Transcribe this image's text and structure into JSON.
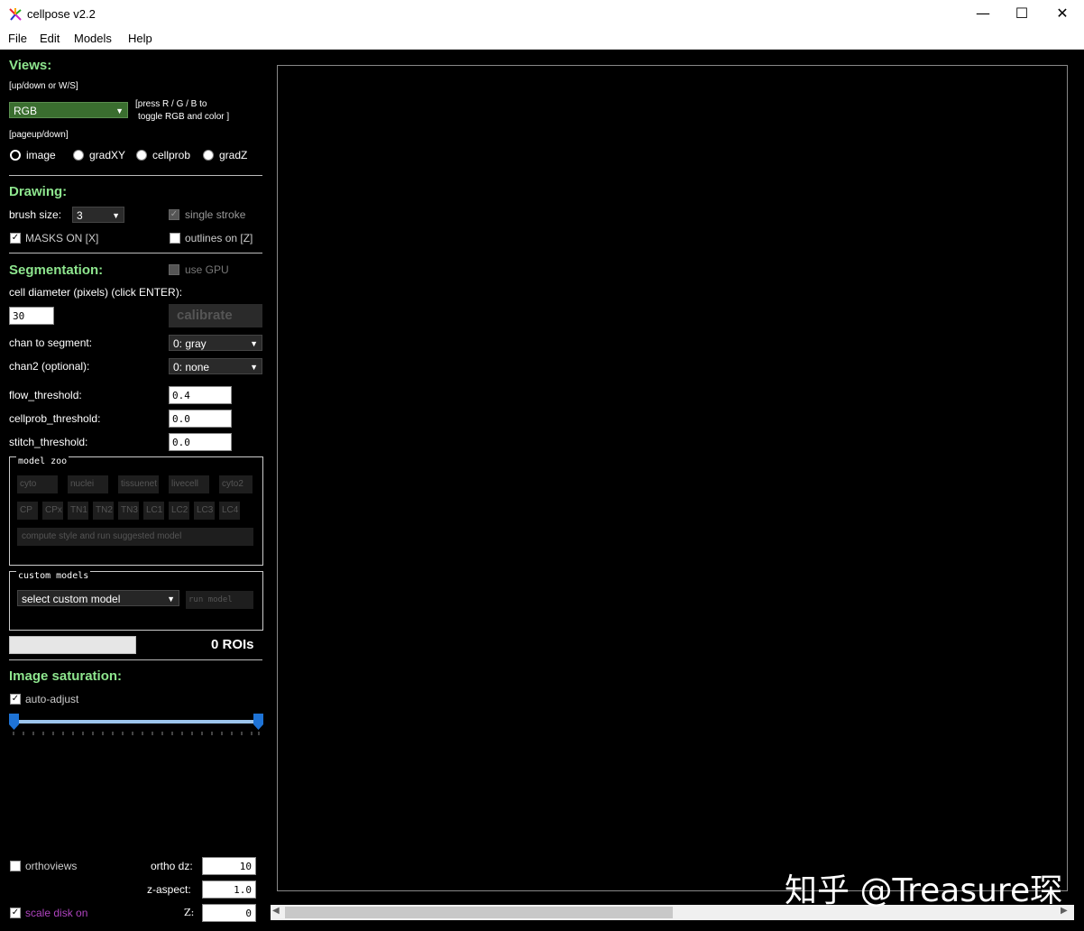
{
  "window": {
    "title": "cellpose v2.2",
    "minimize": "—",
    "maximize": "☐",
    "close": "✕"
  },
  "menu": [
    "File",
    "Edit",
    "Models",
    "Help"
  ],
  "views": {
    "header": "Views:",
    "hint_updown": "[up/down or W/S]",
    "color_mode": "RGB",
    "color_hint_line1": "[press R / G / B to",
    "color_hint_line2": "toggle RGB and color ]",
    "hint_pageupdown": "[pageup/down]",
    "radios": [
      {
        "label": "image",
        "selected": true
      },
      {
        "label": "gradXY",
        "selected": false
      },
      {
        "label": "cellprob",
        "selected": false
      },
      {
        "label": "gradZ",
        "selected": false
      }
    ]
  },
  "drawing": {
    "header": "Drawing:",
    "brush_label": "brush size:",
    "brush_value": "3",
    "single_stroke": {
      "label": "single stroke",
      "checked": true,
      "enabled": false
    },
    "masks_on": {
      "label": "MASKS ON [X]",
      "checked": true
    },
    "outlines_on": {
      "label": "outlines on [Z]",
      "checked": false
    }
  },
  "segmentation": {
    "header": "Segmentation:",
    "use_gpu": {
      "label": "use GPU",
      "checked": false,
      "enabled": false
    },
    "diameter_label": "cell diameter (pixels) (click ENTER):",
    "diameter_value": "30",
    "calibrate_label": "calibrate",
    "chan_label": "chan to segment:",
    "chan_value": "0: gray",
    "chan2_label": "chan2 (optional):",
    "chan2_value": "0: none",
    "flow_label": "flow_threshold:",
    "flow_value": "0.4",
    "cellprob_label": "cellprob_threshold:",
    "cellprob_value": "0.0",
    "stitch_label": "stitch_threshold:",
    "stitch_value": "0.0"
  },
  "model_zoo": {
    "title": "model zoo",
    "row1": [
      "cyto",
      "nuclei",
      "tissuenet",
      "livecell",
      "cyto2"
    ],
    "row2": [
      "CP",
      "CPx",
      "TN1",
      "TN2",
      "TN3",
      "LC1",
      "LC2",
      "LC3",
      "LC4"
    ],
    "compute_label": "compute style and run suggested model"
  },
  "custom_models": {
    "title": "custom models",
    "select_value": "select custom model",
    "run_label": "run model"
  },
  "progress": {
    "value": 0
  },
  "rois_label": "0 ROIs",
  "saturation": {
    "header": "Image saturation:",
    "auto_adjust": {
      "label": "auto-adjust",
      "checked": true
    },
    "slider_low": 0.0,
    "slider_high": 1.0
  },
  "bottom": {
    "orthoviews": {
      "label": "orthoviews",
      "checked": false
    },
    "ortho_dz_label": "ortho dz:",
    "ortho_dz_value": "10",
    "z_aspect_label": "z-aspect:",
    "z_aspect_value": "1.0",
    "scale_disk": {
      "label": "scale disk on",
      "checked": true
    },
    "z_label": "Z:",
    "z_value": "0"
  },
  "watermark": "知乎 @Treasure琛",
  "colors": {
    "header_green": "#8ee68e",
    "rgb_combo_green": "#3a6e2f",
    "scale_disk_purple": "#b044c0",
    "slider_blue": "#1e73d6"
  },
  "icons": {
    "app": "cellpose-logo-icon",
    "combo_arrow": "chevron-down-icon",
    "scroll_left": "arrow-left-icon",
    "scroll_right": "arrow-right-icon"
  }
}
